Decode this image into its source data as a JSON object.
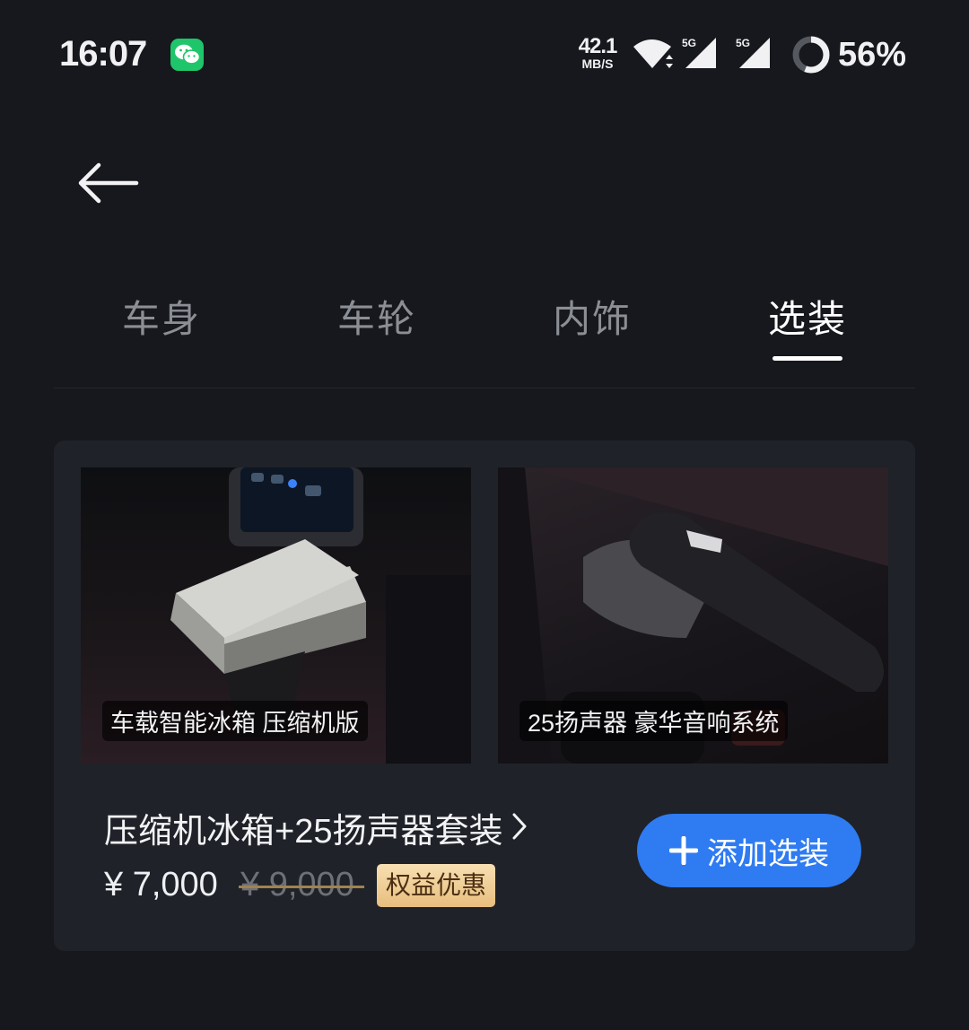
{
  "status_bar": {
    "time": "16:07",
    "network_speed_value": "42.1",
    "network_speed_unit": "MB/S",
    "signal1_label": "5G",
    "signal2_label": "5G",
    "battery": "56%",
    "battery_level": 0.56,
    "notification_icon": "wechat-icon"
  },
  "header": {
    "back_icon": "arrow-left-icon"
  },
  "tabs": [
    {
      "label": "车身",
      "active": false
    },
    {
      "label": "车轮",
      "active": false
    },
    {
      "label": "内饰",
      "active": false
    },
    {
      "label": "选装",
      "active": true
    }
  ],
  "package": {
    "images": [
      {
        "caption": "车载智能冰箱 压缩机版"
      },
      {
        "caption": "25扬声器 豪华音响系统"
      }
    ],
    "title": "压缩机冰箱+25扬声器套装",
    "price": "¥ 7,000",
    "original_price": "¥ 9,000",
    "badge": "权益优惠",
    "add_button_label": "添加选装"
  },
  "colors": {
    "background": "#16181d",
    "card": "#1f2228",
    "accent_blue": "#2f7bf2",
    "badge_gold": "#e8bf7e",
    "wechat_green": "#1fc56a"
  }
}
